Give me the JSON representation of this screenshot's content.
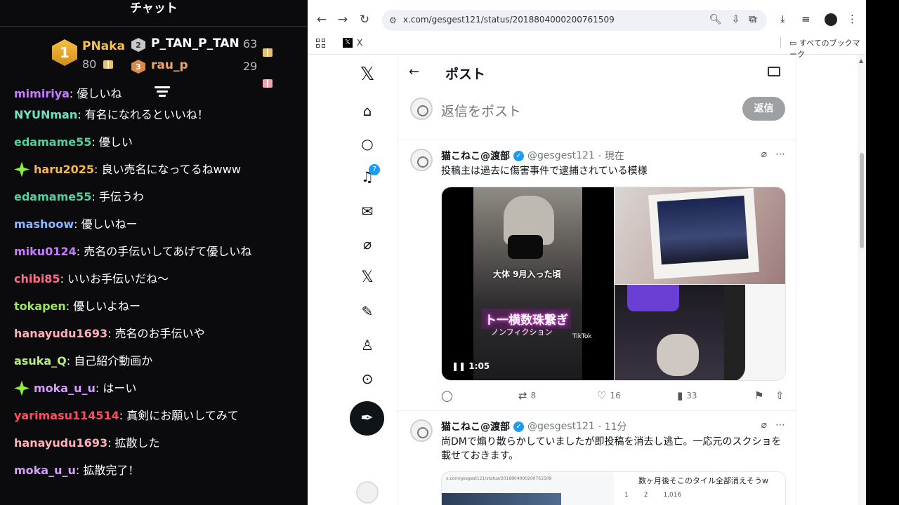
{
  "chat": {
    "title": "チャット",
    "leaderboard": [
      {
        "rank": "1",
        "name": "PNaka",
        "count": "80"
      },
      {
        "rank": "2",
        "name": "P_TAN_P_TAN",
        "count": "63"
      },
      {
        "rank": "3",
        "name": "rau_p",
        "count": "29"
      }
    ],
    "partial_top": {
      "user": "mimiriya",
      "text": ": 優しいね"
    },
    "messages": [
      {
        "user": "NYUNman",
        "color": "#6fe3c1",
        "text": ": 有名になれるといいね！",
        "badge": false
      },
      {
        "user": "edamame55",
        "color": "#4fd1a0",
        "text": ": 優しい",
        "badge": false
      },
      {
        "user": "haru2025",
        "color": "#f5b94d",
        "text": ": 良い売名になってるねwww",
        "badge": true
      },
      {
        "user": "edamame55",
        "color": "#4fd1a0",
        "text": ": 手伝うわ",
        "badge": false
      },
      {
        "user": "mashoow",
        "color": "#8bb8ff",
        "text": ": 優しいねー",
        "badge": false
      },
      {
        "user": "miku0124",
        "color": "#c77dff",
        "text": ": 売名の手伝いしてあげて優しいね",
        "badge": false
      },
      {
        "user": "chibi85",
        "color": "#ff6b8a",
        "text": ": いいお手伝いだね〜",
        "badge": false
      },
      {
        "user": "tokapen",
        "color": "#9be85f",
        "text": ": 優しいよねー",
        "badge": false
      },
      {
        "user": "hanayudu1693",
        "color": "#ffb0b8",
        "text": ": 売名のお手伝いや",
        "badge": false
      },
      {
        "user": "asuka_Q",
        "color": "#b6f07a",
        "text": ": 自己紹介動画か",
        "badge": false
      },
      {
        "user": "moka_u_u",
        "color": "#d79cff",
        "text": ": はーい",
        "badge": true
      },
      {
        "user": "yarimasu114514",
        "color": "#ff4d5e",
        "text": ": 真剣にお願いしてみて",
        "badge": false
      },
      {
        "user": "hanayudu1693",
        "color": "#ffb0b8",
        "text": ": 拡散した",
        "badge": false
      },
      {
        "user": "moka_u_u",
        "color": "#d79cff",
        "text": ": 拡散完了！",
        "badge": false
      }
    ]
  },
  "browser": {
    "url": "x.com/gesgest121/status/2018804000200761509",
    "bookmark_x_label": "X",
    "bookmark_folder": "すべてのブックマーク"
  },
  "xnav": {
    "logo": "𝕏",
    "notif_count": "7",
    "icons": [
      "x-logo",
      "home-icon",
      "search-icon",
      "bell-icon",
      "mail-icon",
      "grok-icon",
      "x-premium-icon",
      "edit-icon",
      "profile-icon",
      "more-icon"
    ]
  },
  "post": {
    "header_title": "ポスト",
    "reply_placeholder": "返信をポスト",
    "reply_button": "返信",
    "tweet1": {
      "name": "猫こねこ@渡部",
      "handle": "@gesgest121",
      "time": "· 現在",
      "body": "投稿主は過去に傷害事件で逮捕されている模様",
      "video_caption1": "大体 9月入った頃",
      "video_caption2": "ト一横数珠繋ぎ",
      "video_caption3": "ノンフィクション",
      "video_watermark": "TikTok",
      "video_time": "1:05",
      "retweets": "8",
      "likes": "16",
      "views": "33"
    },
    "tweet2": {
      "name": "猫こねこ@渡部",
      "handle": "@gesgest121",
      "time": "· 11分",
      "body": "尚DMで煽り散らかしていましたが即投稿を消去し逃亡。一応元のスクショを載せておきます。",
      "embed_text": "数ヶ月後そこのタイル全部消えそうw",
      "embed_stats": [
        "1",
        "2",
        "1,016"
      ]
    }
  }
}
